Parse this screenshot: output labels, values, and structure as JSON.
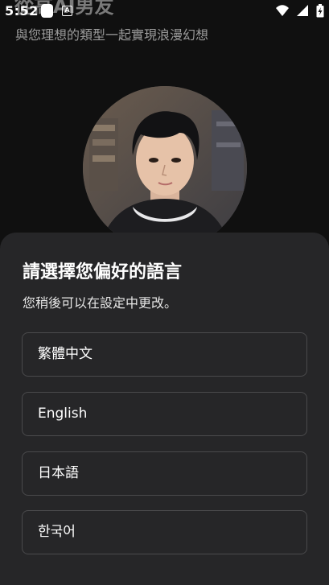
{
  "status_bar": {
    "time": "5:52",
    "notification_icon_glyph": "A",
    "icons": [
      "app-notification-icon",
      "accessibility-notification-icon",
      "wifi-icon",
      "cellular-signal-icon",
      "battery-charging-icon"
    ]
  },
  "background": {
    "title": "從高AI男友",
    "subtitle": "與您理想的類型一起實現浪漫幻想",
    "avatar": "portrait of young man"
  },
  "language_sheet": {
    "title": "請選擇您偏好的語言",
    "subtitle": "您稍後可以在設定中更改。",
    "options": [
      {
        "label": "繁體中文"
      },
      {
        "label": "English"
      },
      {
        "label": "日本語"
      },
      {
        "label": "한국어"
      }
    ]
  },
  "colors": {
    "sheet_background": "#262628",
    "option_border": "#4a4a4c",
    "text_primary": "#ffffff",
    "text_secondary": "#e6e6e6"
  }
}
